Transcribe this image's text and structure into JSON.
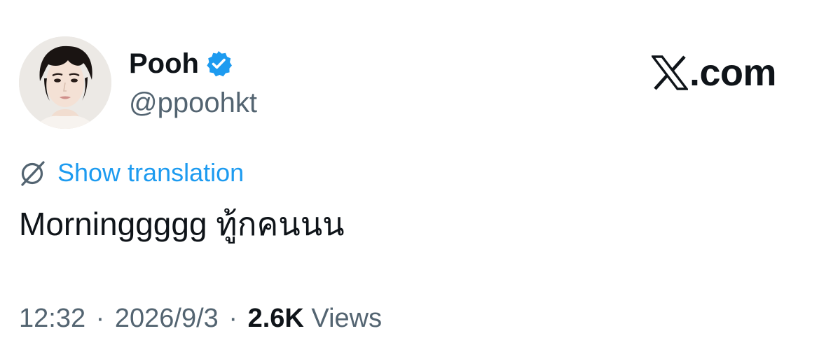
{
  "author": {
    "display_name": "Pooh",
    "handle": "@ppoohkt",
    "verified": true,
    "verified_color": "#1d9bf0",
    "avatar_icon": "profile-photo"
  },
  "brand": {
    "label": ".com",
    "icon": "x-logo"
  },
  "translate": {
    "label": "Show translation",
    "icon": "globe-translate-icon",
    "color": "#1d9bf0"
  },
  "tweet": {
    "text": "Morninggggg ทู้กคนนน"
  },
  "meta": {
    "time": "12:32",
    "separator": "·",
    "date": "2026/9/3",
    "views_count": "2.6K",
    "views_label": "Views"
  }
}
